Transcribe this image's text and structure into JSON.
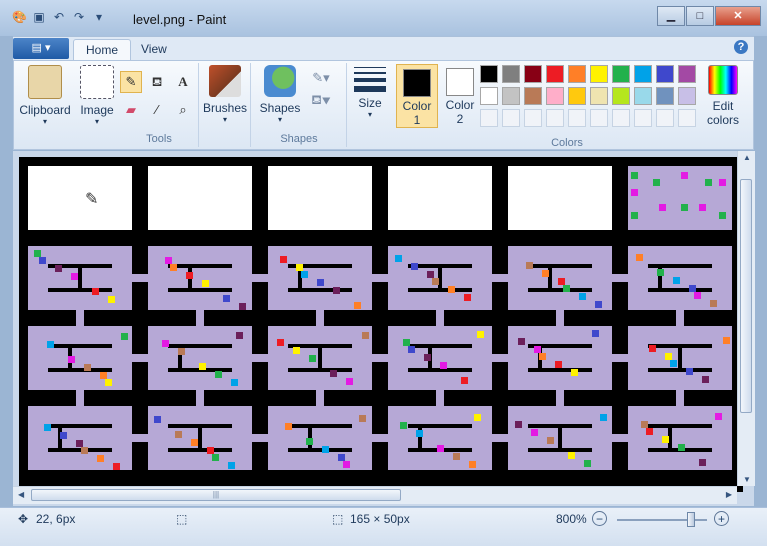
{
  "window": {
    "title": "level.png - Paint",
    "controls": [
      "minimize",
      "maximize",
      "close"
    ]
  },
  "quick_access": [
    "paint-icon",
    "save-icon",
    "undo-icon",
    "redo-icon",
    "customize-icon"
  ],
  "tabs": [
    {
      "label": "Home",
      "active": true
    },
    {
      "label": "View",
      "active": false
    }
  ],
  "ribbon": {
    "clipboard": {
      "label": "Clipboard"
    },
    "image": {
      "label": "Image"
    },
    "tools": {
      "label": "Tools",
      "items": [
        "pencil-icon",
        "fill-icon",
        "text-icon",
        "eraser-icon",
        "color-picker-icon",
        "magnifier-icon"
      ]
    },
    "brushes": {
      "label": "Brushes"
    },
    "shapes": {
      "label": "Shapes",
      "group_label": "Shapes"
    },
    "size": {
      "label": "Size"
    },
    "color1": {
      "label": "Color",
      "num": "1",
      "value": "#000000"
    },
    "color2": {
      "label": "Color",
      "num": "2",
      "value": "#ffffff"
    },
    "colors_label": "Colors",
    "edit_colors": {
      "line1": "Edit",
      "line2": "colors"
    },
    "palette_row1": [
      "#000000",
      "#7f7f7f",
      "#880015",
      "#ed1c24",
      "#ff7f27",
      "#fff200",
      "#22b14c",
      "#00a2e8",
      "#3f48cc",
      "#a349a4"
    ],
    "palette_row2": [
      "#ffffff",
      "#c3c3c3",
      "#b97a57",
      "#ffaec9",
      "#ffc90e",
      "#efe4b0",
      "#b5e61d",
      "#99d9ea",
      "#7092be",
      "#c8bfe7"
    ]
  },
  "status": {
    "cursor_pos": "22, 6px",
    "image_size": "165 × 50px",
    "zoom": "800%",
    "zoom_level_fraction": 0.82
  },
  "colors": {
    "canvas_bg": "#000000",
    "room_fill": "#b6a8d6",
    "ribbon_accent": "#1f5aa6"
  }
}
